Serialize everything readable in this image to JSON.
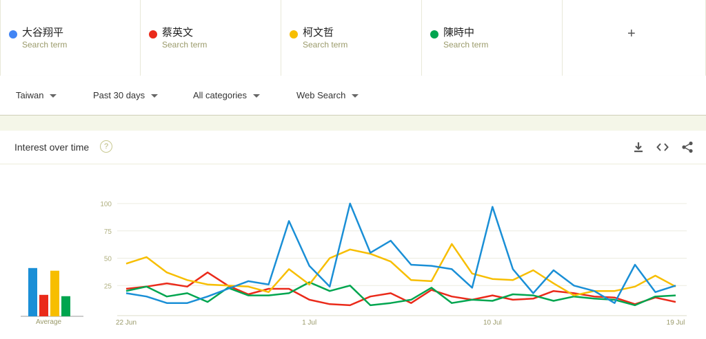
{
  "search_terms": [
    {
      "name": "大谷翔平",
      "sub": "Search term",
      "color": "#4285f4"
    },
    {
      "name": "蔡英文",
      "sub": "Search term",
      "color": "#ea2a1a"
    },
    {
      "name": "柯文哲",
      "sub": "Search term",
      "color": "#f7be00"
    },
    {
      "name": "陳時中",
      "sub": "Search term",
      "color": "#00a54f"
    }
  ],
  "add_label": "+",
  "filters": {
    "region": "Taiwan",
    "period": "Past 30 days",
    "category": "All categories",
    "search_type": "Web Search"
  },
  "card": {
    "title": "Interest over time",
    "help": "?",
    "icons": [
      "download-icon",
      "embed-icon",
      "share-icon"
    ]
  },
  "average_label": "Average",
  "chart_data": {
    "type": "line",
    "title": "Interest over time",
    "x_labels_shown": [
      "22 Jun",
      "1 Jul",
      "10 Jul",
      "19 Jul"
    ],
    "x": [
      "22 Jun",
      "23 Jun",
      "24 Jun",
      "25 Jun",
      "26 Jun",
      "27 Jun",
      "28 Jun",
      "29 Jun",
      "30 Jun",
      "1 Jul",
      "2 Jul",
      "3 Jul",
      "4 Jul",
      "5 Jul",
      "6 Jul",
      "7 Jul",
      "8 Jul",
      "9 Jul",
      "10 Jul",
      "11 Jul",
      "12 Jul",
      "13 Jul",
      "14 Jul",
      "15 Jul",
      "16 Jul",
      "17 Jul",
      "18 Jul",
      "19 Jul"
    ],
    "ylim": [
      0,
      100
    ],
    "y_ticks": [
      25,
      50,
      75,
      100
    ],
    "grid": true,
    "series": [
      {
        "name": "大谷翔平",
        "color": "#1a8fd6",
        "values": [
          18,
          15,
          9,
          9,
          15,
          22,
          29,
          26,
          84,
          43,
          24,
          100,
          55,
          66,
          44,
          43,
          40,
          23,
          97,
          40,
          18,
          39,
          25,
          20,
          9,
          44,
          19,
          25
        ]
      },
      {
        "name": "蔡英文",
        "color": "#ea2a1a",
        "values": [
          22,
          24,
          27,
          24,
          37,
          25,
          17,
          22,
          22,
          12,
          8,
          7,
          15,
          18,
          9,
          21,
          15,
          12,
          16,
          12,
          13,
          20,
          18,
          15,
          14,
          8,
          14,
          10
        ]
      },
      {
        "name": "柯文哲",
        "color": "#f7be00",
        "values": [
          45,
          51,
          37,
          30,
          26,
          25,
          24,
          19,
          40,
          26,
          50,
          58,
          54,
          47,
          30,
          29,
          63,
          36,
          31,
          30,
          39,
          27,
          16,
          20,
          20,
          24,
          34,
          24
        ]
      },
      {
        "name": "陳時中",
        "color": "#00a54f",
        "values": [
          20,
          24,
          15,
          18,
          10,
          23,
          16,
          16,
          18,
          28,
          20,
          25,
          7,
          9,
          12,
          23,
          9,
          12,
          11,
          17,
          16,
          11,
          15,
          13,
          12,
          7,
          15,
          16
        ]
      }
    ],
    "averages": [
      {
        "name": "大谷翔平",
        "value": 36
      },
      {
        "name": "蔡英文",
        "value": 16
      },
      {
        "name": "柯文哲",
        "value": 34
      },
      {
        "name": "陳時中",
        "value": 15
      }
    ]
  }
}
